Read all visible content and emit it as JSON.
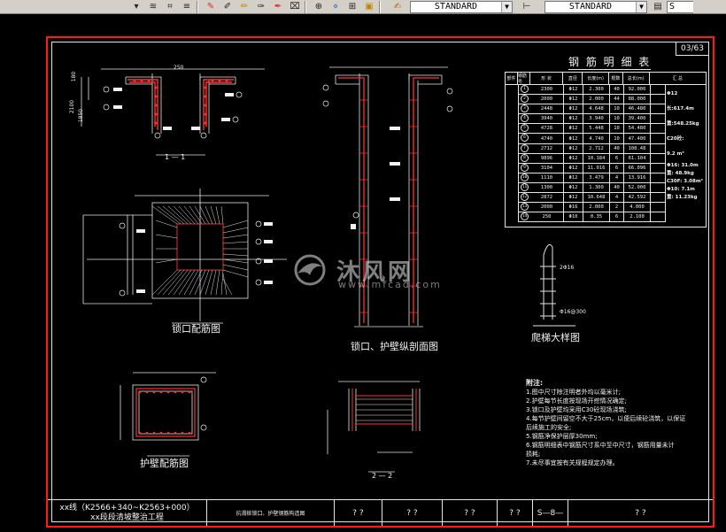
{
  "toolbar": {
    "text_style": "STANDARD",
    "dim_style": "STANDARD",
    "truncated_label": "S"
  },
  "sheet": {
    "page_number": "03/63",
    "table_title": "钢 筋 明 细 表",
    "views": {
      "section_1": "1 — 1",
      "lock_plan": "锁口配筋图",
      "profile": "锁口、护壁纵剖面图",
      "ladder": "爬梯大样图",
      "wall": "护壁配筋图",
      "section_2": "2 — 2"
    },
    "dims": {
      "d180": "180",
      "d2100": "2100",
      "d1850": "1850",
      "d250": "250",
      "rebar1": "2Φ16",
      "rebar2": "Φ16@300"
    },
    "table": {
      "headers": [
        "部件",
        "钢筋号",
        "形 状",
        "直径",
        "长度(m)",
        "根数",
        "总长(m)",
        "汇 总"
      ],
      "rows": [
        [
          "1",
          "2300",
          "Φ12",
          "2.300",
          "40",
          "92.000"
        ],
        [
          "2",
          "2000",
          "Φ12",
          "2.000",
          "44",
          "88.000"
        ],
        [
          "3",
          "2448",
          "Φ12",
          "4.648",
          "10",
          "46.480"
        ],
        [
          "4",
          "3940",
          "Φ12",
          "3.940",
          "10",
          "39.400"
        ],
        [
          "5",
          "4728",
          "Φ12",
          "5.448",
          "10",
          "54.480"
        ],
        [
          "6",
          "4740",
          "Φ12",
          "4.740",
          "10",
          "47.400"
        ],
        [
          "7",
          "2712",
          "Φ12",
          "2.712",
          "40",
          "108.48"
        ],
        [
          "8",
          "9896",
          "Φ12",
          "10.184",
          "6",
          "61.104"
        ],
        [
          "9",
          "3104",
          "Φ12",
          "11.016",
          "6",
          "66.096"
        ],
        [
          "10",
          "1110",
          "Φ12",
          "3.479",
          "4",
          "13.916"
        ],
        [
          "11",
          "1300",
          "Φ12",
          "1.300",
          "40",
          "52.000"
        ],
        [
          "12",
          "2872",
          "Φ12",
          "10.648",
          "4",
          "42.592"
        ],
        [
          "13",
          "2000",
          "Φ16",
          "2.000",
          "2",
          "4.000"
        ],
        [
          "14",
          "250",
          "Φ10",
          "0.35",
          "6",
          "2.100"
        ]
      ],
      "summary": [
        "Φ12",
        "长:617.4m",
        "重:548.25kg",
        "C20砼:",
        "9.2 m³",
        "Φ16: 31.0m",
        "重: 48.9kg",
        "C30F: 3.08m³",
        "Φ10: 7.1m",
        "重: 11.23kg"
      ]
    },
    "notes": {
      "heading": "附注:",
      "lines": [
        "1.图中尺寸除注明者外均以毫米计;",
        "2.护壁每节长度按现场开挖情况确定;",
        "3.锁口及护壁均采用C30砼现场浇筑;",
        "4.每节护壁间留空不大于25cm，以便后续砼浇筑，以保证",
        "   后续施工的安全;",
        "5.钢筋净保护层厚30mm;",
        "6.钢筋明细表中钢筋尺寸系中至中尺寸，钢筋用量未计",
        "   损耗;",
        "7.未尽事宜按有关规程规定办理。"
      ]
    },
    "watermark": {
      "text": "沐风网",
      "url": "www.mfcad.com"
    },
    "title_block": {
      "project_line1": "xx线（K2566+340~K2563+000）",
      "project_line2": "xx段段清坡整治工程",
      "drawing_name": "抗滑桩锁口、护壁钢筋构造图",
      "cell_a": "? ?",
      "cell_b": "? ?",
      "cell_c": "? ?",
      "cell_d": "? ?",
      "sheet_no": "S—8—",
      "cell_e": "? ?"
    }
  }
}
